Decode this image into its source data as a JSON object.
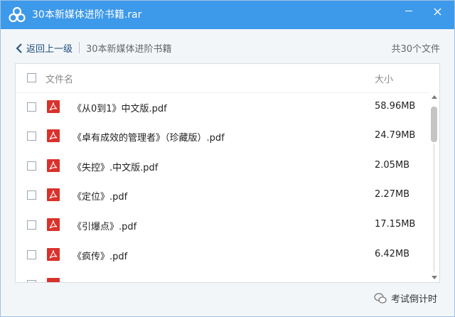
{
  "window": {
    "title": "30本新媒体进阶书籍.rar"
  },
  "nav": {
    "back_label": "返回上一级",
    "breadcrumb": "30本新媒体进阶书籍",
    "file_count": "共30个文件"
  },
  "list": {
    "header": {
      "name": "文件名",
      "size": "大小"
    },
    "files": [
      {
        "name": "《从0到1》中文版.pdf",
        "size": "58.96MB"
      },
      {
        "name": "《卓有成效的管理者》（珍藏版）.pdf",
        "size": "24.79MB"
      },
      {
        "name": "《失控》.中文版.pdf",
        "size": "2.05MB"
      },
      {
        "name": "《定位》.pdf",
        "size": "2.27MB"
      },
      {
        "name": "《引爆点》.pdf",
        "size": "17.15MB"
      },
      {
        "name": "《疯传》.pdf",
        "size": "6.42MB"
      }
    ]
  },
  "watermark": {
    "text": "考试倒计时"
  },
  "colors": {
    "titlebar": "#3d99e9",
    "pdf_icon": "#d9322c"
  }
}
